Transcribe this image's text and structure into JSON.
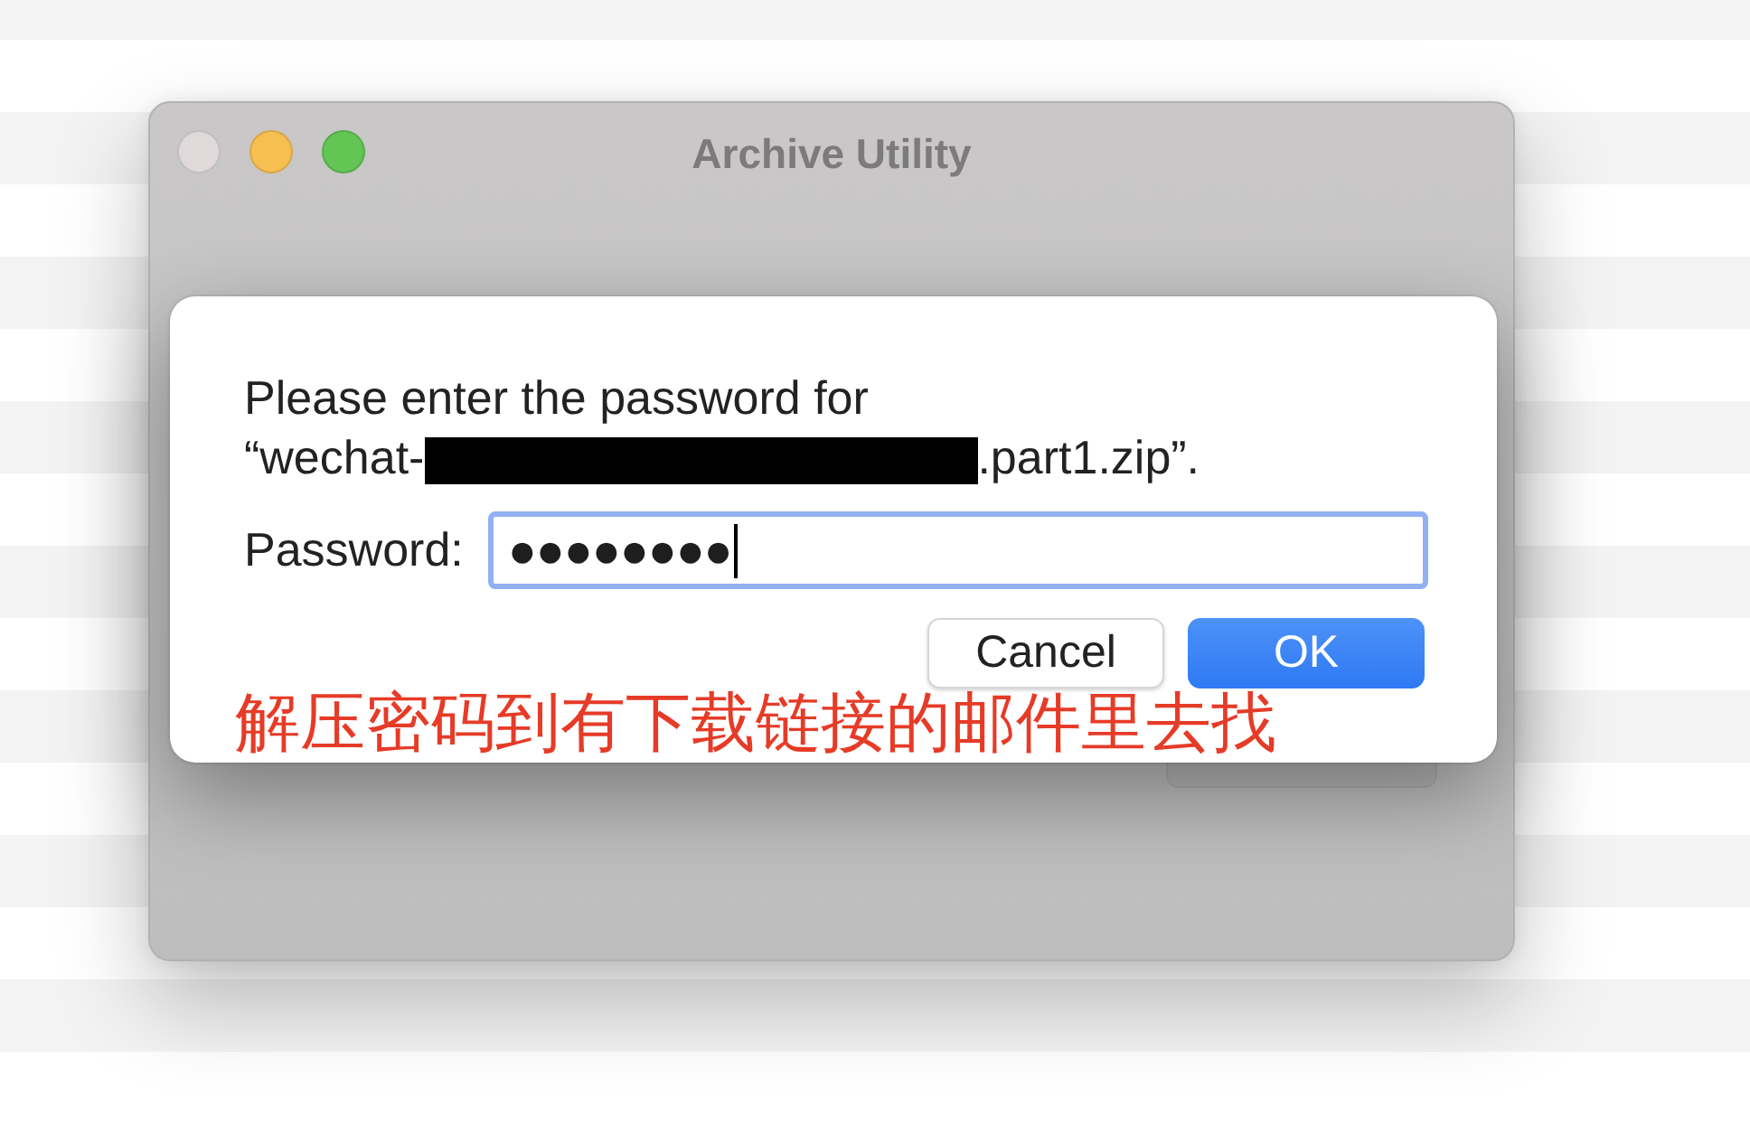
{
  "window": {
    "title": "Archive Utility",
    "traffic_lights": [
      {
        "color": "#dfd9da"
      },
      {
        "color": "#f6bf50"
      },
      {
        "color": "#62c554"
      }
    ],
    "background_button": {
      "dimmed": true
    }
  },
  "dialog": {
    "message": "Please enter the password for",
    "filename_start": "“wechat-",
    "filename_redacted": true,
    "filename_end": ".part1.zip”.",
    "password": {
      "label": "Password:",
      "value": "●●●●●●●●",
      "focused": true
    },
    "buttons": [
      {
        "label": "Cancel",
        "kind": "secondary"
      },
      {
        "label": "OK",
        "kind": "default"
      }
    ],
    "annotation": "解压密码到有下载链接的邮件里去找"
  }
}
